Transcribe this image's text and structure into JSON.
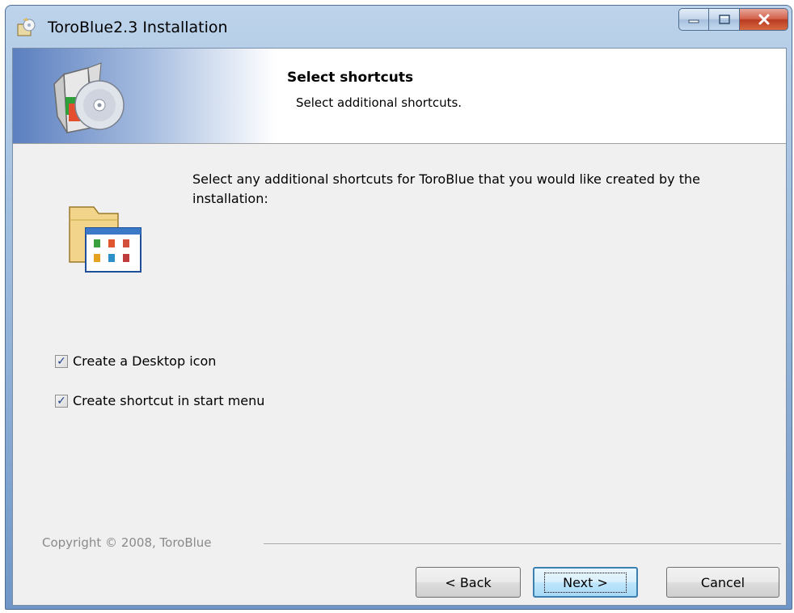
{
  "window": {
    "title": "ToroBlue2.3 Installation",
    "caption_buttons": [
      "minimize-icon",
      "maximize-icon",
      "close-icon"
    ]
  },
  "header": {
    "title": "Select shortcuts",
    "subtitle": "Select additional shortcuts.",
    "icon": "install-package-cd-icon"
  },
  "body": {
    "icon": "folder-shortcuts-icon",
    "intro": "Select any additional shortcuts for ToroBlue that you would like created by the installation:",
    "options": [
      {
        "label": "Create a Desktop icon",
        "checked": true
      },
      {
        "label": "Create shortcut in start menu",
        "checked": true
      }
    ]
  },
  "footer": {
    "copyright": "Copyright © 2008, ToroBlue",
    "back_label": "< Back",
    "next_label": "Next >",
    "cancel_label": "Cancel"
  },
  "colors": {
    "header_gradient_start": "#5b7fbf",
    "client_background": "#f0f0f0",
    "close_button": "#c6452c",
    "focus_button_border": "#3c7fb1"
  }
}
